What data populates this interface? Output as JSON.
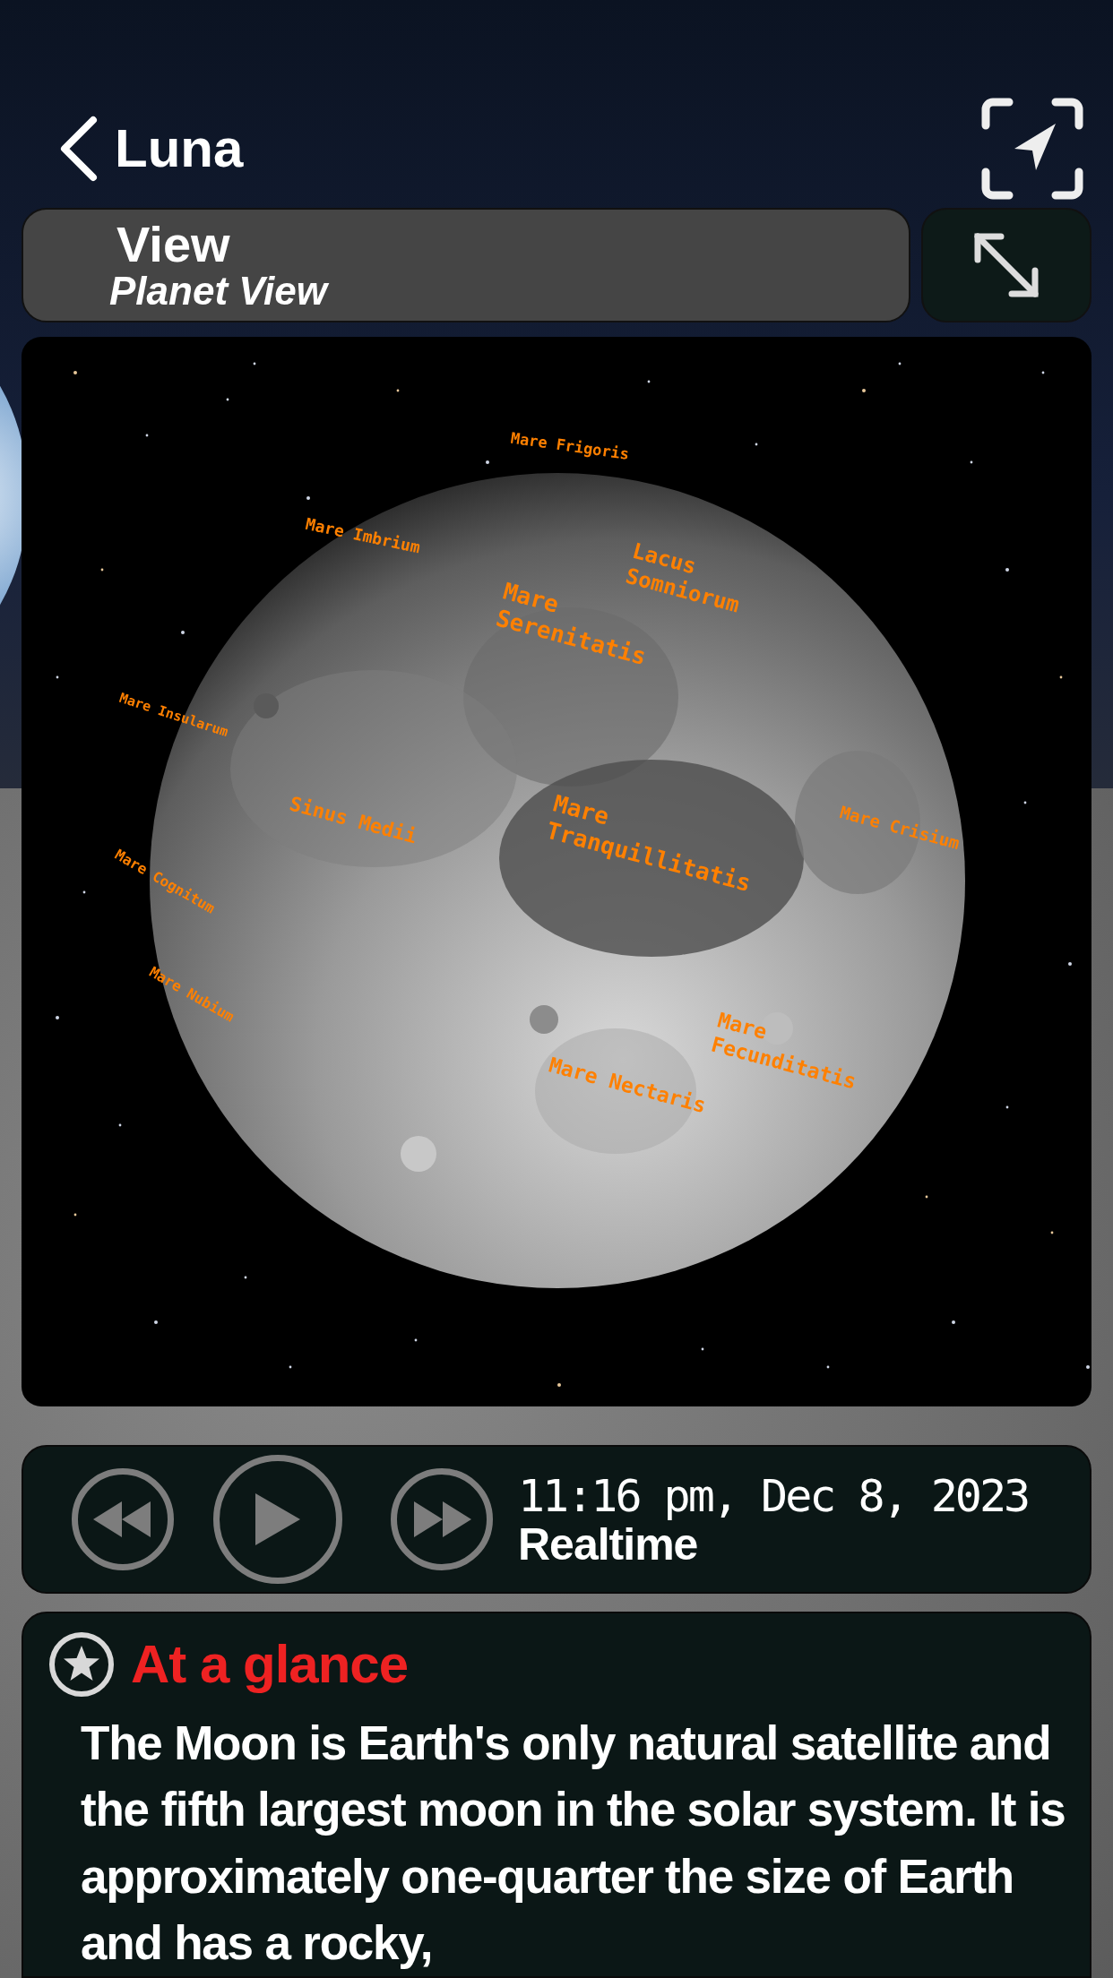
{
  "header": {
    "title": "Luna"
  },
  "view_selector": {
    "label": "View",
    "value": "Planet View"
  },
  "scene": {
    "labels": [
      {
        "text": "Mare Frigoris"
      },
      {
        "text": "Mare Imbrium"
      },
      {
        "text": "Mare Insularum"
      },
      {
        "text": "Lacus Somniorum"
      },
      {
        "text": "Mare Serenitatis"
      },
      {
        "text": "Mare Tranquillitatis"
      },
      {
        "text": "Mare Crisium"
      },
      {
        "text": "Sinus Medii"
      },
      {
        "text": "Mare Cognitum"
      },
      {
        "text": "Mare Nubium"
      },
      {
        "text": "Mare Nectaris"
      },
      {
        "text": "Mare Fecunditatis"
      }
    ]
  },
  "playback": {
    "time": "11:16 pm, Dec 8, 2023",
    "mode": "Realtime",
    "playing": false
  },
  "glance": {
    "title": "At a glance",
    "text": "The Moon is Earth's only natural satellite and the fifth largest moon in the solar system. It is approximately one-quarter the size of Earth and has a rocky,"
  }
}
